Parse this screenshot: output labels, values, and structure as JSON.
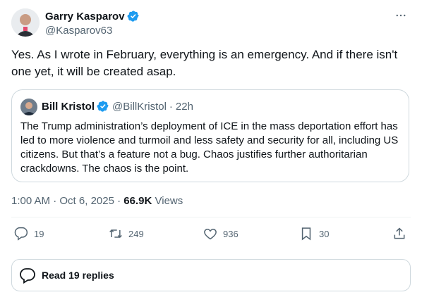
{
  "author": {
    "name": "Garry Kasparov",
    "handle": "@Kasparov63",
    "verified": true
  },
  "tweet": {
    "text": "Yes. As I wrote in February, everything is an emergency. And if there isn't one yet, it will be created asap."
  },
  "quoted": {
    "name": "Bill Kristol",
    "handle": "@BillKristol",
    "separator": "·",
    "time": "22h",
    "text": "The Trump administration’s deployment of ICE in the mass deportation effort has led to more violence and turmoil and less safety and security for all, including US citizens. But that’s a feature not a bug. Chaos justifies further authoritarian crackdowns. The chaos is the point."
  },
  "meta": {
    "time": "1:00 AM",
    "dot": "·",
    "date": "Oct 6, 2025",
    "views_count": "66.9K",
    "views_label": "Views"
  },
  "actions": {
    "replies": "19",
    "reposts": "249",
    "likes": "936",
    "bookmarks": "30"
  },
  "read_replies": {
    "label": "Read 19 replies"
  },
  "colors": {
    "verified": "#1d9bf0",
    "text": "#0f1419",
    "muted": "#536471",
    "border": "#cfd9de"
  },
  "icons": [
    "verified-badge-icon",
    "more-icon",
    "reply-icon",
    "repost-icon",
    "like-icon",
    "bookmark-icon",
    "share-icon",
    "replies-bubble-icon"
  ]
}
